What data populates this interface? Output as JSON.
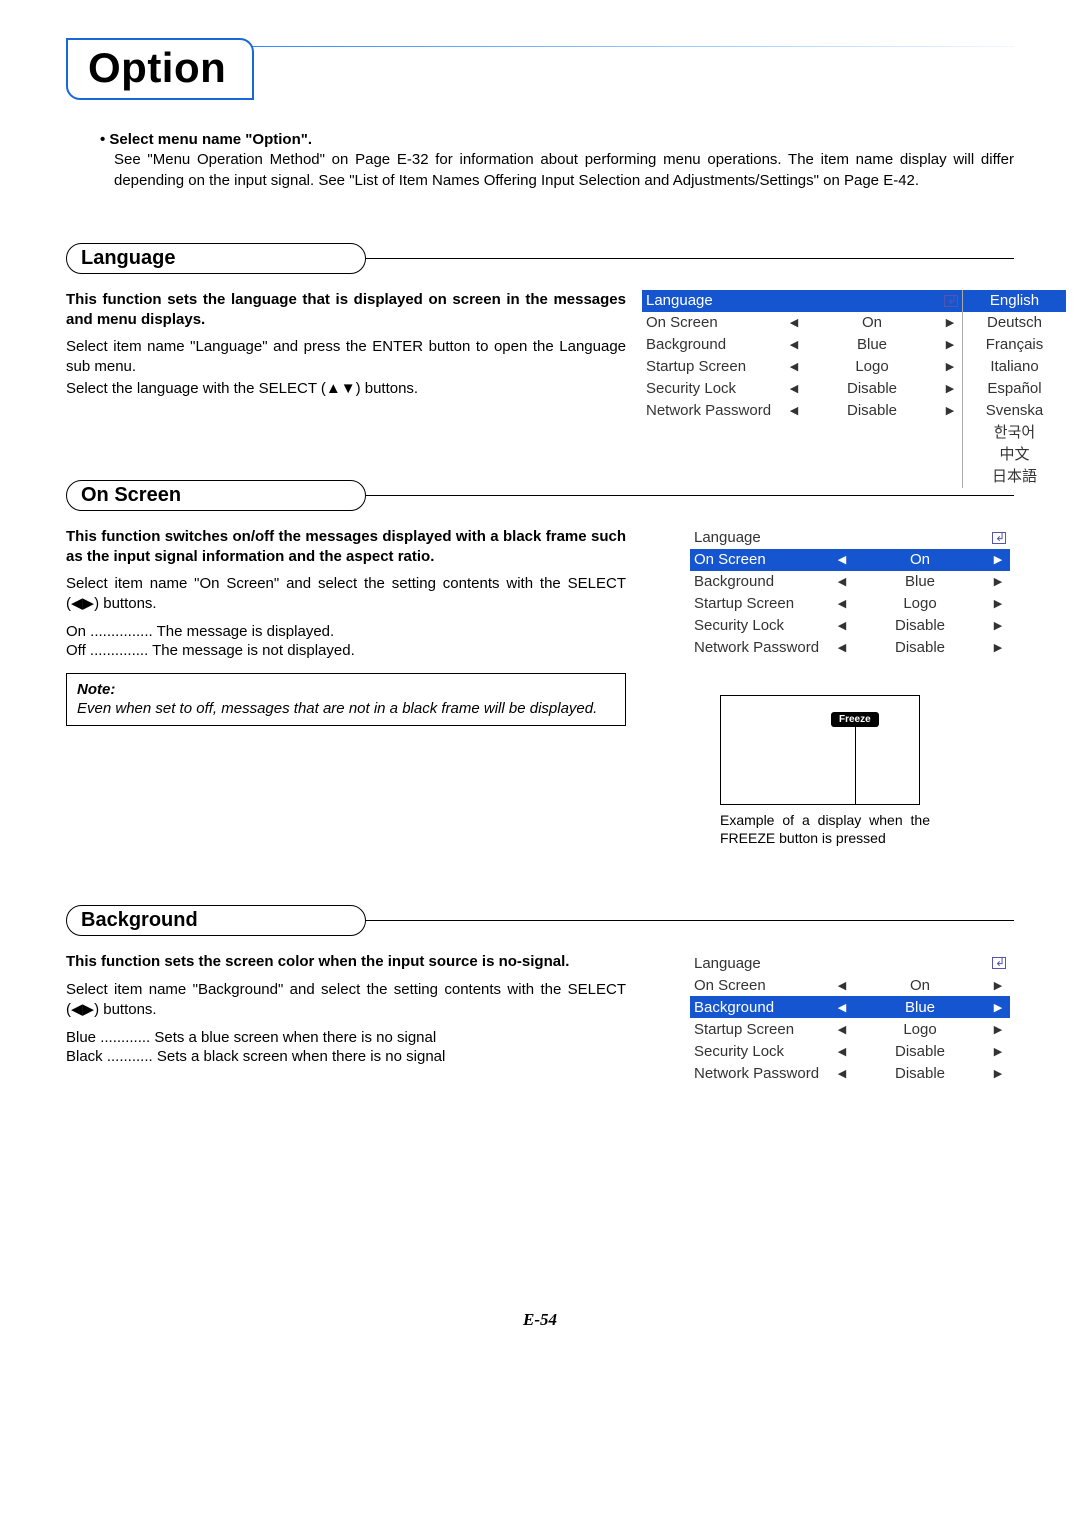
{
  "title": "Option",
  "intro": {
    "bullet": "• Select menu name \"Option\".",
    "body": "See \"Menu Operation Method\" on Page E-32 for information about performing menu operations. The item name display will differ depending on the input signal. See \"List of Item Names Offering Input Selection and Adjustments/Settings\" on Page E-42."
  },
  "sections": {
    "language": {
      "heading": "Language",
      "bold": "This function sets the language that is displayed on screen in the messages and menu displays.",
      "p1": "Select item name \"Language\" and press the ENTER button to open the Language sub menu.",
      "p2": "Select the language with the SELECT (▲▼) buttons.",
      "osd": {
        "rows": [
          {
            "label": "Language",
            "value": "",
            "enter": true,
            "selected": true,
            "arrows": false
          },
          {
            "label": "On Screen",
            "value": "On",
            "enter": false,
            "selected": false,
            "arrows": true
          },
          {
            "label": "Background",
            "value": "Blue",
            "enter": false,
            "selected": false,
            "arrows": true
          },
          {
            "label": "Startup Screen",
            "value": "Logo",
            "enter": false,
            "selected": false,
            "arrows": true
          },
          {
            "label": "Security Lock",
            "value": "Disable",
            "enter": false,
            "selected": false,
            "arrows": true
          },
          {
            "label": "Network Password",
            "value": "Disable",
            "enter": false,
            "selected": false,
            "arrows": true
          }
        ]
      },
      "languages": [
        "English",
        "Deutsch",
        "Français",
        "Italiano",
        "Español",
        "Svenska",
        "한국어",
        "中文",
        "日本語"
      ],
      "lang_selected": 0
    },
    "onscreen": {
      "heading": "On Screen",
      "bold": "This function switches on/off the messages displayed with a black frame such as the input signal information and the aspect ratio.",
      "p1": "Select item name \"On Screen\" and select the setting contents with the SELECT (◀▶) buttons.",
      "defs": [
        "On ............... The message is displayed.",
        "Off .............. The message is not displayed."
      ],
      "note_h": "Note:",
      "note_b": "Even when set to off, messages that are not in a black frame will be displayed.",
      "osd": {
        "rows": [
          {
            "label": "Language",
            "value": "",
            "enter": true,
            "selected": false,
            "arrows": false
          },
          {
            "label": "On Screen",
            "value": "On",
            "enter": false,
            "selected": true,
            "arrows": true
          },
          {
            "label": "Background",
            "value": "Blue",
            "enter": false,
            "selected": false,
            "arrows": true
          },
          {
            "label": "Startup Screen",
            "value": "Logo",
            "enter": false,
            "selected": false,
            "arrows": true
          },
          {
            "label": "Security Lock",
            "value": "Disable",
            "enter": false,
            "selected": false,
            "arrows": true
          },
          {
            "label": "Network Password",
            "value": "Disable",
            "enter": false,
            "selected": false,
            "arrows": true
          }
        ]
      },
      "freeze_label": "Freeze",
      "freeze_caption": "Example of a display when the FREEZE button is pressed"
    },
    "background": {
      "heading": "Background",
      "bold": "This function sets the screen color when the input source is no-signal.",
      "p1": "Select item name \"Background\" and select the setting contents with the SELECT (◀▶) buttons.",
      "defs": [
        "Blue ............ Sets a blue screen when there is no signal",
        "Black ........... Sets a black screen when there is no signal"
      ],
      "osd": {
        "rows": [
          {
            "label": "Language",
            "value": "",
            "enter": true,
            "selected": false,
            "arrows": false
          },
          {
            "label": "On Screen",
            "value": "On",
            "enter": false,
            "selected": false,
            "arrows": true
          },
          {
            "label": "Background",
            "value": "Blue",
            "enter": false,
            "selected": true,
            "arrows": true
          },
          {
            "label": "Startup Screen",
            "value": "Logo",
            "enter": false,
            "selected": false,
            "arrows": true
          },
          {
            "label": "Security Lock",
            "value": "Disable",
            "enter": false,
            "selected": false,
            "arrows": true
          },
          {
            "label": "Network Password",
            "value": "Disable",
            "enter": false,
            "selected": false,
            "arrows": true
          }
        ]
      }
    }
  },
  "footer": "E-54",
  "glyphs": {
    "left": "◀",
    "right": "▶"
  }
}
